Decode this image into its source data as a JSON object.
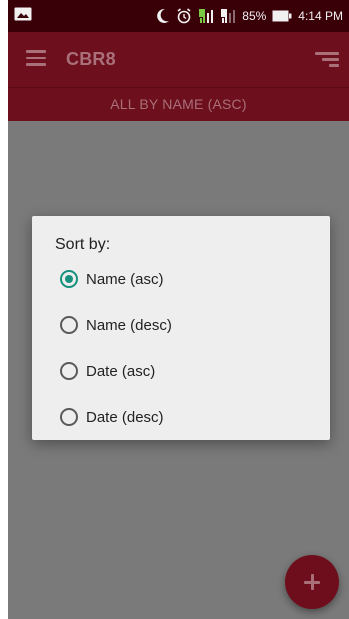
{
  "status_bar": {
    "battery_percent": "85%",
    "time": "4:14 PM",
    "icons": [
      "image-notification-icon",
      "moon-icon",
      "alarm-icon",
      "signal-sim1-icon",
      "signal-sim2-icon",
      "battery-icon"
    ]
  },
  "app_bar": {
    "title": "CBR8",
    "menu_icon": "hamburger-menu-icon",
    "sort_icon": "sort-icon"
  },
  "sort_header": {
    "label": "ALL BY NAME (ASC)"
  },
  "dialog": {
    "title": "Sort by:",
    "options": [
      {
        "label": "Name (asc)",
        "selected": true
      },
      {
        "label": "Name (desc)",
        "selected": false
      },
      {
        "label": "Date (asc)",
        "selected": false
      },
      {
        "label": "Date (desc)",
        "selected": false
      }
    ]
  },
  "fab": {
    "icon": "plus-icon"
  },
  "colors": {
    "status_bar_bg": "#3a0008",
    "app_bar_bg": "#6d0f1d",
    "overlay_bg": "#7a7a7a",
    "dialog_bg": "#eeeeee",
    "accent_radio": "#17907e",
    "muted_text": "#a97079"
  }
}
